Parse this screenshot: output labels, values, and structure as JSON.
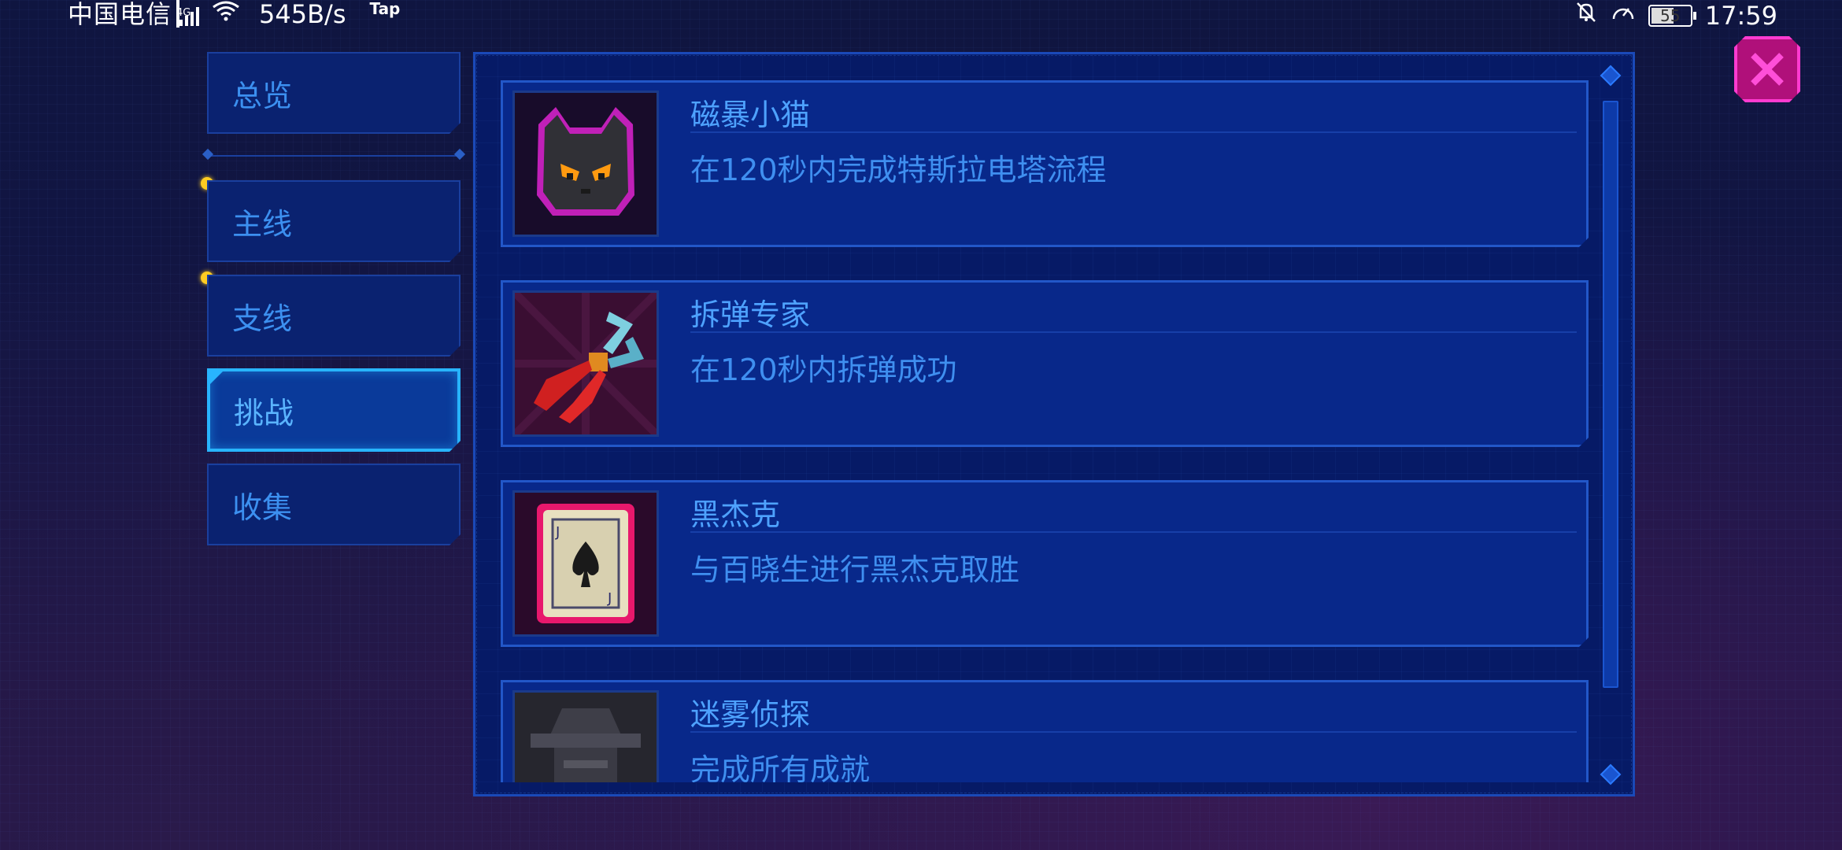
{
  "status_bar": {
    "carrier": "中国电信",
    "network": "4G",
    "speed": "545B/s",
    "tap_label": "Tap",
    "battery": "55",
    "time": "17:59"
  },
  "sidebar": {
    "tabs": [
      {
        "label": "总览"
      },
      {
        "label": "主线"
      },
      {
        "label": "支线"
      },
      {
        "label": "挑战"
      },
      {
        "label": "收集"
      }
    ]
  },
  "achievements": [
    {
      "title": "磁暴小猫",
      "description": "在120秒内完成特斯拉电塔流程",
      "icon": "cat-icon"
    },
    {
      "title": "拆弹专家",
      "description": "在120秒内拆弹成功",
      "icon": "pliers-icon"
    },
    {
      "title": "黑杰克",
      "description": "与百晓生进行黑杰克取胜",
      "icon": "playing-card-icon"
    },
    {
      "title": "迷雾侦探",
      "description": "完成所有成就",
      "icon": "detective-icon"
    }
  ],
  "colors": {
    "accent": "#28b4ff",
    "close": "#ff3bd0",
    "card_bg": "#08288a",
    "text": "#4ea2ff",
    "indicator": "#ffcc22"
  }
}
